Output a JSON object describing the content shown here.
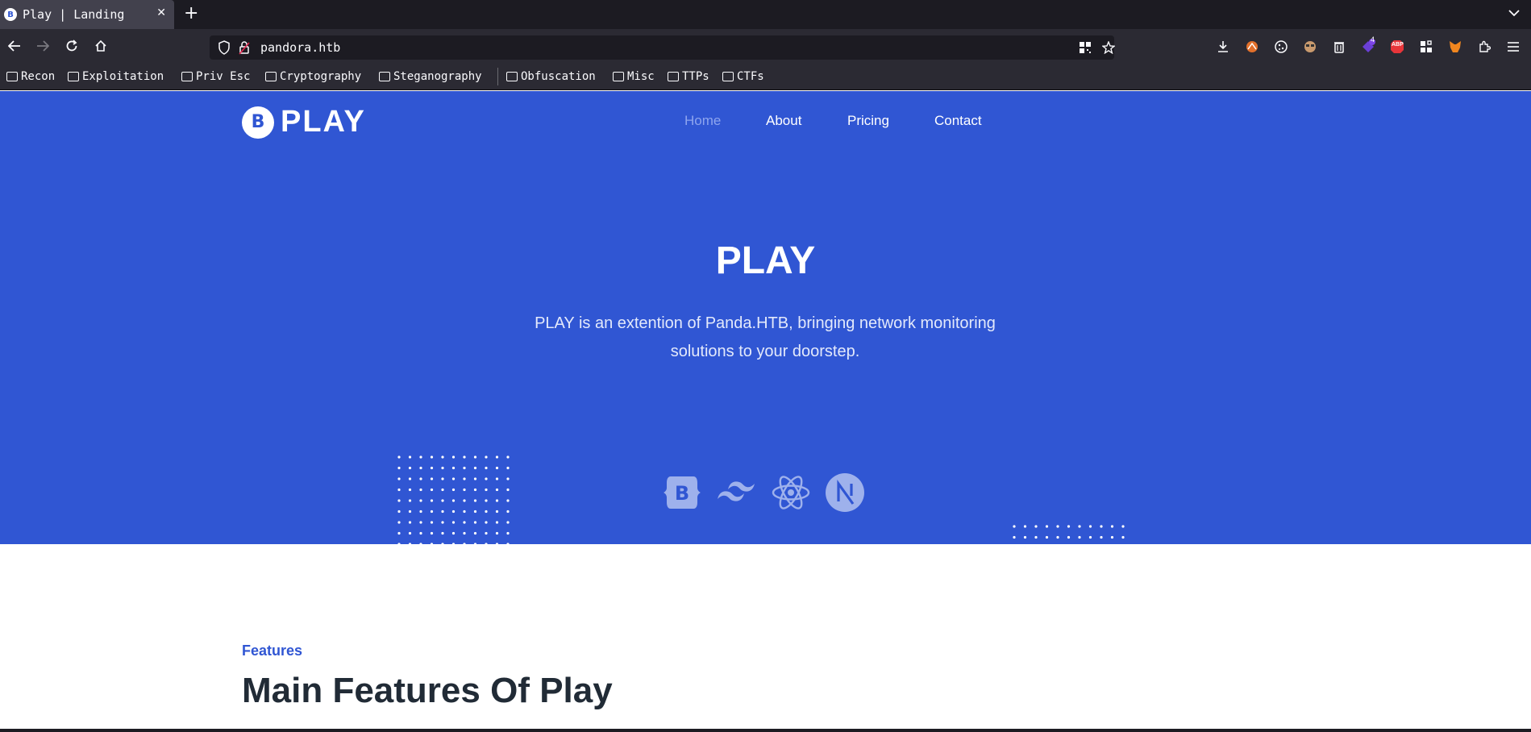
{
  "browser": {
    "tab_title": "Play | Landing",
    "favicon_letter": "B",
    "new_tab": "+",
    "url": "pandora.htb",
    "bookmarks": [
      "Recon",
      "Exploitation",
      "Priv Esc",
      "Cryptography",
      "Steganography",
      "Obfuscation",
      "Misc",
      "TTPs",
      "CTFs"
    ],
    "extension_badge": "4",
    "abp_label": "ABP"
  },
  "site": {
    "logo_letter": "B",
    "logo_text": "PLAY",
    "nav": {
      "home": "Home",
      "about": "About",
      "pricing": "Pricing",
      "contact": "Contact"
    },
    "hero": {
      "title": "PLAY",
      "description": "PLAY is an extention of Panda.HTB, bringing network monitoring solutions to your doorstep."
    },
    "tech_icons": [
      "bootstrap-icon",
      "tailwind-icon",
      "react-icon",
      "nextjs-icon"
    ],
    "features": {
      "label": "Features",
      "title": "Main Features Of Play"
    }
  },
  "colors": {
    "primary": "#3056d3",
    "nav_active": "#8ea5ee",
    "heading_dark": "#212b36",
    "chrome_dark": "#1c1b22",
    "chrome_mid": "#2b2a33"
  }
}
